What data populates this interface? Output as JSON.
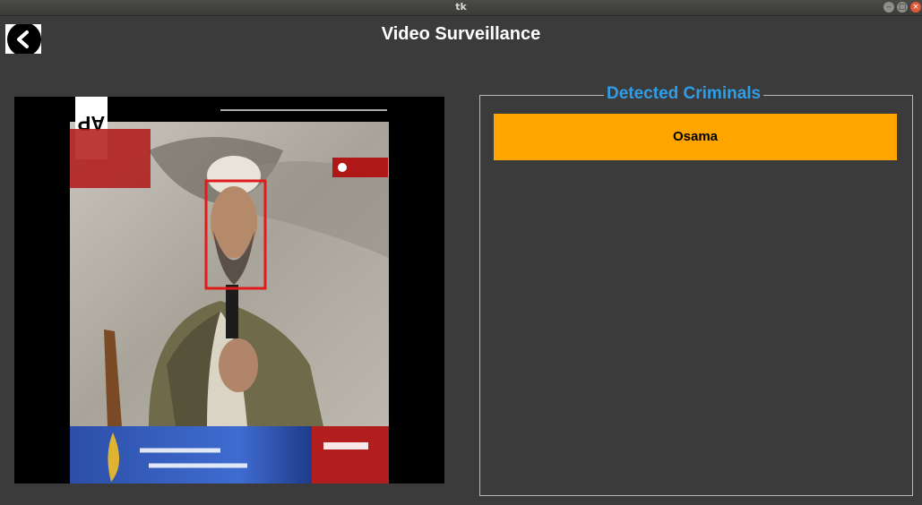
{
  "window": {
    "title": "tk",
    "controls": [
      "minimize-icon",
      "maximize-icon",
      "close-icon"
    ]
  },
  "header": {
    "back_icon": "chevron-left-icon",
    "title": "Video Surveillance"
  },
  "video": {
    "overlay_logo": "AP",
    "detection_box_color": "#e01b1b"
  },
  "detected_panel": {
    "title": "Detected Criminals",
    "title_color": "#2f9ee8",
    "items": [
      {
        "name": "Osama",
        "color": "#ffa500"
      }
    ]
  }
}
